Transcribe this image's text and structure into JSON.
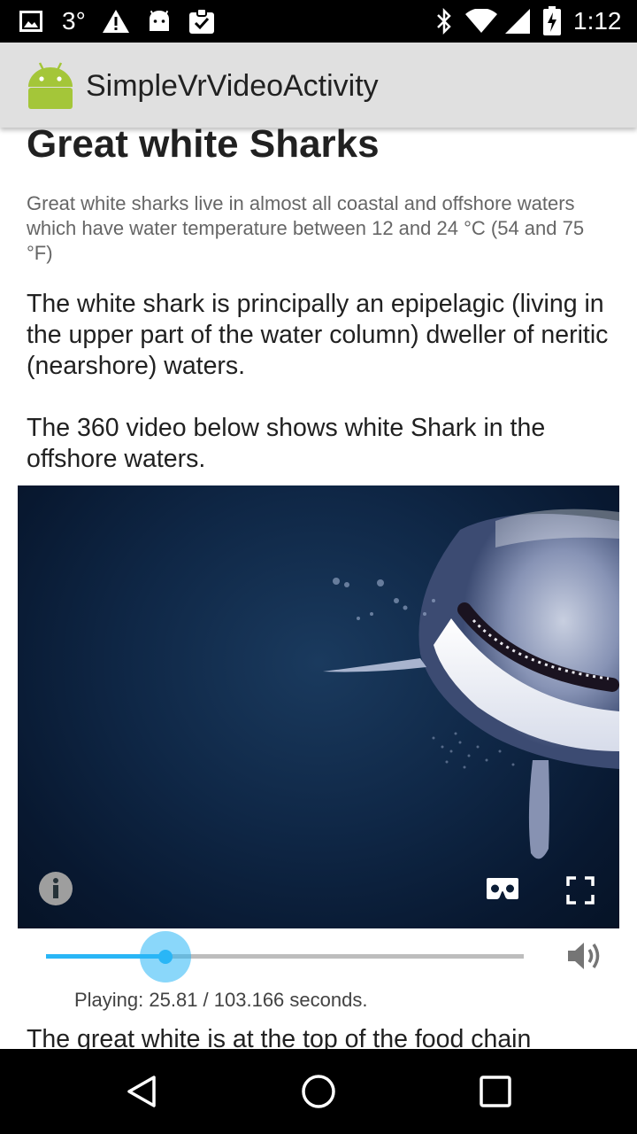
{
  "status_bar": {
    "temperature": "3°",
    "time": "1:12",
    "icons": [
      "image-icon",
      "warning-icon",
      "android-icon",
      "clipboard-check-icon",
      "bluetooth-icon",
      "wifi-icon",
      "signal-icon",
      "battery-charging-icon"
    ]
  },
  "app_bar": {
    "title": "SimpleVrVideoActivity",
    "icon": "android-logo-icon"
  },
  "article": {
    "heading": "Great white Sharks",
    "subtext": "Great white sharks live in almost all coastal and offshore waters which have water temperature between 12 and 24 °C (54 and 75 °F)",
    "paragraph1": "The white shark is principally an epipelagic (living in the upper part of the water column) dweller of neritic (nearshore) waters.",
    "paragraph2": "The 360 video below shows white Shark in the offshore waters.",
    "paragraph3": "The great white is at the top of the food chain"
  },
  "video": {
    "controls": [
      "info-icon",
      "cardboard-vr-icon",
      "fullscreen-icon"
    ],
    "progress_seconds": 25.81,
    "duration_seconds": 103.166,
    "status_text": "Playing: 25.81 / 103.166 seconds.",
    "volume_icon": "volume-icon"
  },
  "nav_bar": {
    "buttons": [
      "back-icon",
      "home-icon",
      "recents-icon"
    ]
  },
  "colors": {
    "accent": "#29b6f6",
    "app_bar": "#e0e0e0",
    "android_green": "#a4c639"
  }
}
